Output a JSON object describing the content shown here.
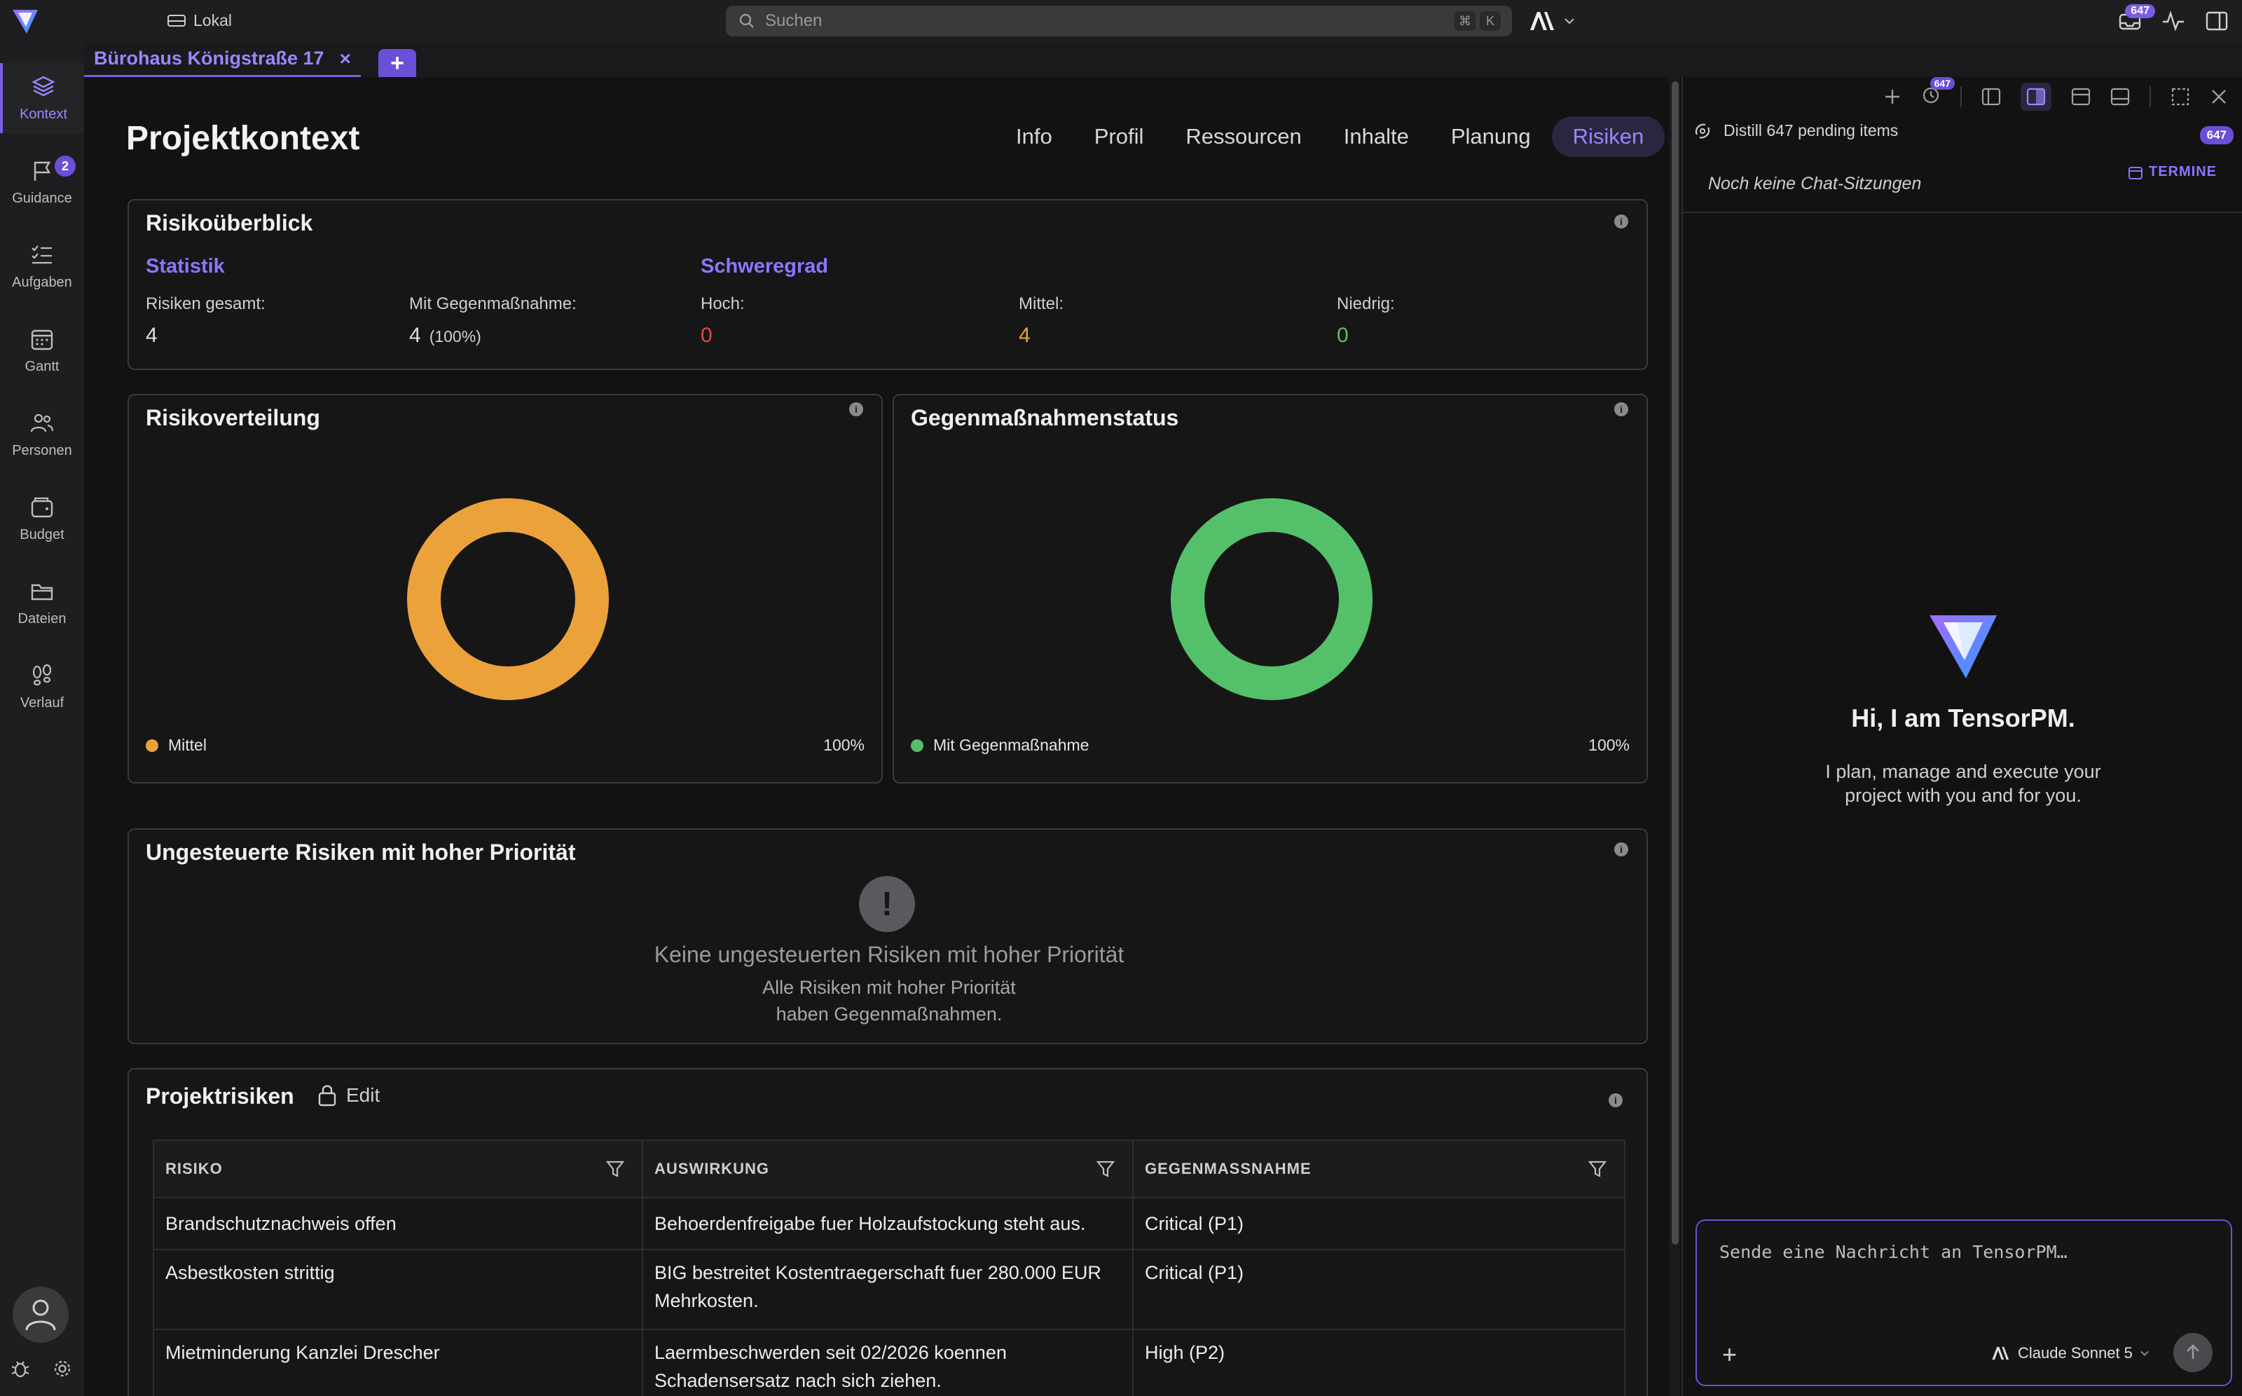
{
  "titlebar": {
    "storage_label": "Lokal",
    "search_placeholder": "Suchen",
    "shortcut_keys": [
      "⌘",
      "K"
    ],
    "inbox_count": "647"
  },
  "doc_tab": {
    "label": "Bürohaus Königstraße 17",
    "close": "×",
    "add": "+"
  },
  "sidebar": {
    "items": [
      {
        "label": "Kontext",
        "icon": "layers-icon",
        "active": true
      },
      {
        "label": "Guidance",
        "icon": "flag-icon",
        "badge": "2"
      },
      {
        "label": "Aufgaben",
        "icon": "checklist-icon"
      },
      {
        "label": "Gantt",
        "icon": "calendar-icon"
      },
      {
        "label": "Personen",
        "icon": "people-icon"
      },
      {
        "label": "Budget",
        "icon": "wallet-icon"
      },
      {
        "label": "Dateien",
        "icon": "folder-icon"
      },
      {
        "label": "Verlauf",
        "icon": "footsteps-icon"
      }
    ]
  },
  "main": {
    "title": "Projektkontext",
    "tabs": [
      {
        "label": "Info"
      },
      {
        "label": "Profil"
      },
      {
        "label": "Ressourcen"
      },
      {
        "label": "Inhalte"
      },
      {
        "label": "Planung"
      },
      {
        "label": "Risiken",
        "active": true
      }
    ]
  },
  "overview": {
    "title": "Risikoüberblick",
    "stats_title": "Statistik",
    "severity_title": "Schweregrad",
    "total_label": "Risiken gesamt:",
    "total_value": "4",
    "mitigated_label": "Mit Gegenmaßnahme:",
    "mitigated_value": "4",
    "mitigated_pct": "(100%)",
    "high_label": "Hoch:",
    "high_value": "0",
    "medium_label": "Mittel:",
    "medium_value": "4",
    "low_label": "Niedrig:",
    "low_value": "0",
    "colors": {
      "high": "#e04848",
      "medium": "#eca23a",
      "low": "#55c06a"
    }
  },
  "distribution": {
    "title": "Risikoverteilung",
    "legend_label": "Mittel",
    "legend_pct": "100%",
    "share": 1.0,
    "color": "#eca23a"
  },
  "mitigation": {
    "title": "Gegenmaßnahmenstatus",
    "legend_label": "Mit Gegenmaßnahme",
    "legend_pct": "100%",
    "share": 1.0,
    "color": "#55c06a"
  },
  "unmanaged": {
    "title": "Ungesteuerte Risiken mit hoher Priorität",
    "empty_title": "Keine ungesteuerten Risiken mit hoher Priorität",
    "empty_sub": "Alle Risiken mit hoher Priorität haben Gegenmaßnahmen."
  },
  "risks_table": {
    "title": "Projektrisiken",
    "edit_label": "Edit",
    "columns": [
      "RISIKO",
      "AUSWIRKUNG",
      "GEGENMASSNAHME"
    ],
    "rows": [
      [
        "Brandschutznachweis offen",
        "Behoerdenfreigabe fuer Holzaufstockung steht aus.",
        "Critical (P1)"
      ],
      [
        "Asbestkosten strittig",
        "BIG bestreitet Kostentraegerschaft fuer 280.000 EUR Mehrkosten.",
        "Critical (P1)"
      ],
      [
        "Mietminderung Kanzlei Drescher",
        "Laermbeschwerden seit 02/2026 koennen Schadensersatz nach sich ziehen.",
        "High (P2)"
      ]
    ]
  },
  "right_panel": {
    "toolbar_badge": "647",
    "distill_label": "Distill 647 pending items",
    "distill_badge": "647",
    "no_chats": "Noch keine Chat-Sitzungen",
    "termine": "TERMINE",
    "hero_title": "Hi, I am TensorPM.",
    "hero_sub": "I plan, manage and execute your project with you and for you.",
    "composer_placeholder": "Sende eine Nachricht an TensorPM…",
    "composer_plus": "+",
    "model_name": "Claude Sonnet 5"
  },
  "theme": {
    "accent": "#7c5ce0",
    "accent_text": "#9d85ff"
  }
}
